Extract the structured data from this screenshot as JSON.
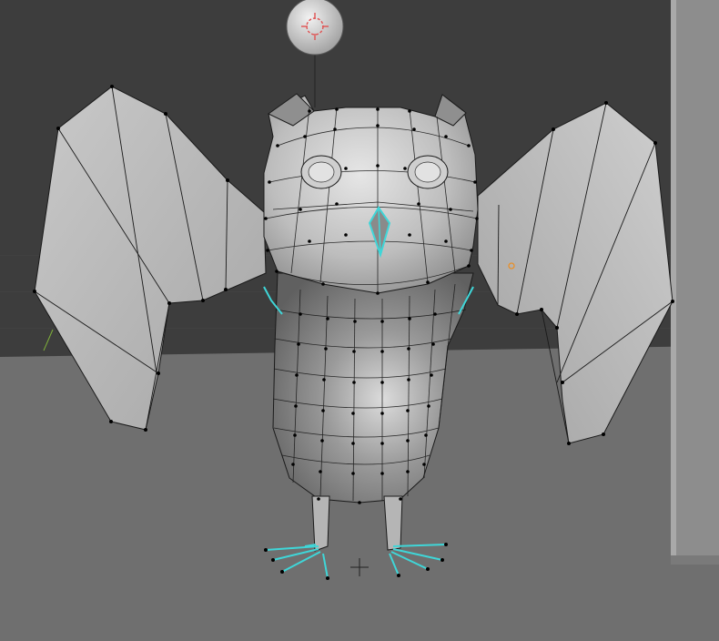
{
  "viewport": {
    "mode": "edit-mode",
    "colors": {
      "background_top": "#3d3d3d",
      "floor": "#6e6e6e",
      "grid_line": "#484848",
      "mesh_face": "#bdbdbd",
      "wire": "#111111",
      "vertex": "#000000",
      "selected_edge": "#3fd6d8",
      "light_object": "#cfcfcf",
      "light_marker": "#e05252",
      "origin_point": "#e8902a",
      "cursor": "#222222",
      "wall": "#8c8c8c"
    }
  },
  "objects": [
    {
      "name": "light-object",
      "icon": "light-point-icon"
    },
    {
      "name": "owl-mesh",
      "icon": "mesh-icon"
    },
    {
      "name": "wall-plane",
      "icon": "plane-icon"
    }
  ]
}
